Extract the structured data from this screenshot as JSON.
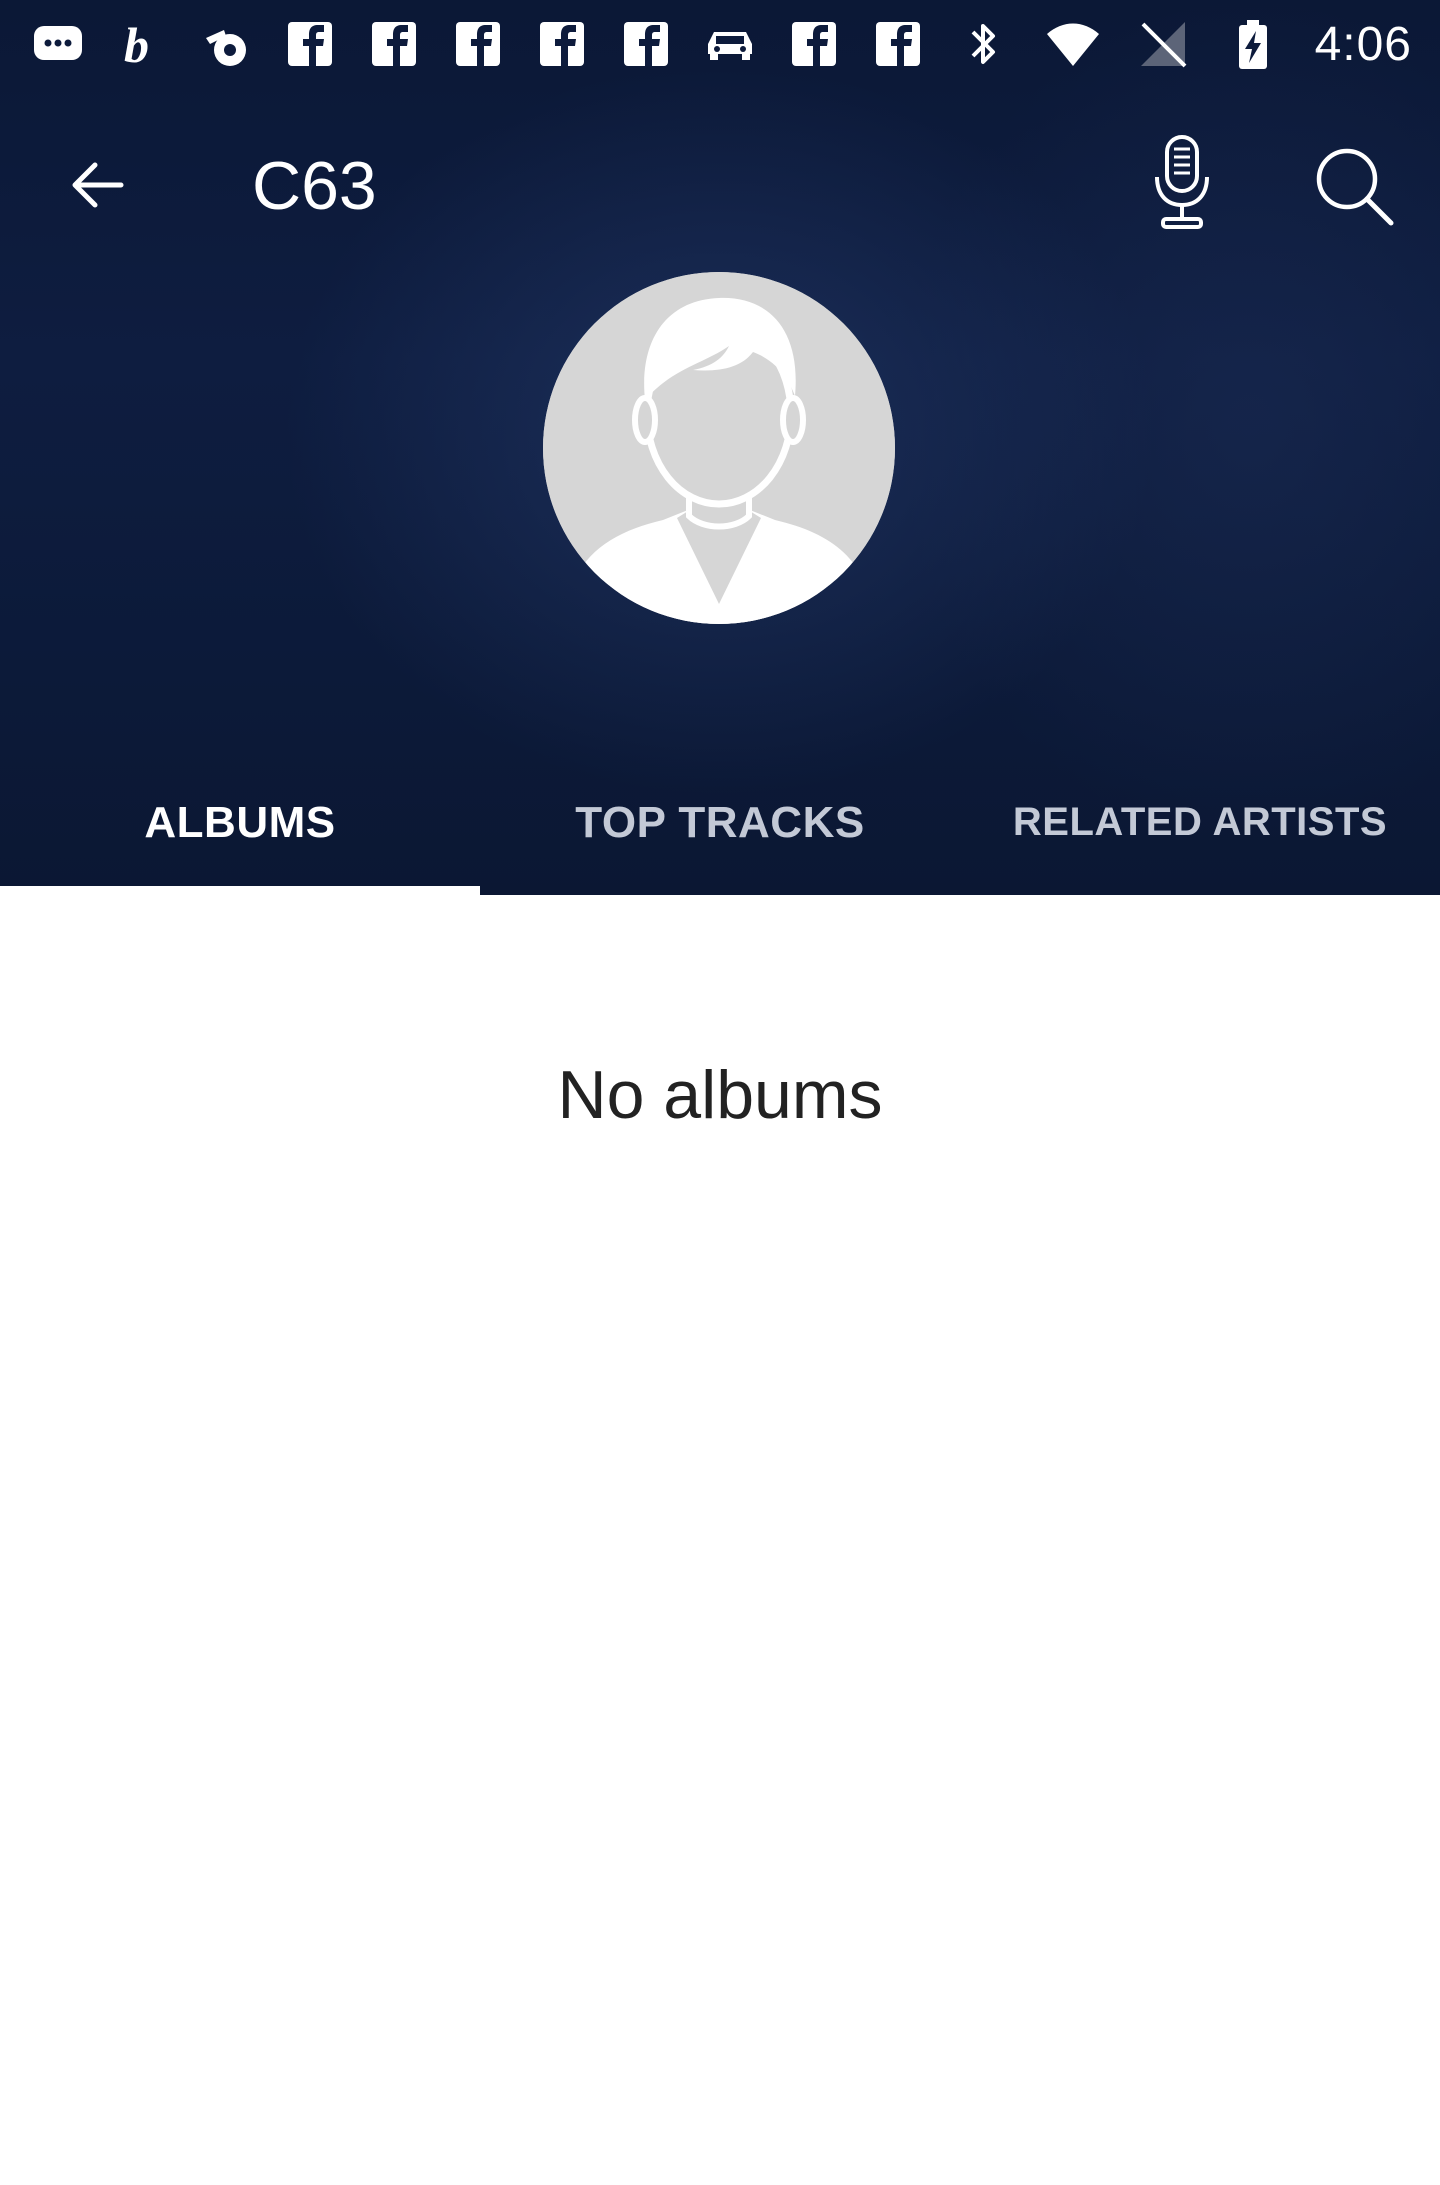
{
  "status_bar": {
    "time": "4:06",
    "notification_icons": [
      "message-icon",
      "b-app-icon",
      "music-note-icon",
      "facebook-icon",
      "facebook-icon",
      "facebook-icon",
      "facebook-icon",
      "facebook-icon",
      "car-icon",
      "facebook-icon",
      "facebook-icon"
    ],
    "system_icons": [
      "bluetooth-icon",
      "wifi-icon",
      "no-signal-icon",
      "battery-charging-icon"
    ]
  },
  "toolbar": {
    "title": "C63",
    "back_icon": "arrow-back-icon",
    "mic_icon": "microphone-icon",
    "search_icon": "search-icon"
  },
  "artist": {
    "avatar": "default-person-avatar"
  },
  "tabs": [
    {
      "label": "ALBUMS",
      "active": true
    },
    {
      "label": "TOP TRACKS",
      "active": false
    },
    {
      "label": "RELATED ARTISTS",
      "active": false
    }
  ],
  "content": {
    "empty_message": "No albums"
  },
  "colors": {
    "header_background": "#0d1b3c",
    "tab_active": "#ffffff",
    "tab_inactive": "#c3c9d6",
    "avatar_background": "#d6d6d6",
    "content_background": "#ffffff",
    "empty_text": "#222222"
  }
}
